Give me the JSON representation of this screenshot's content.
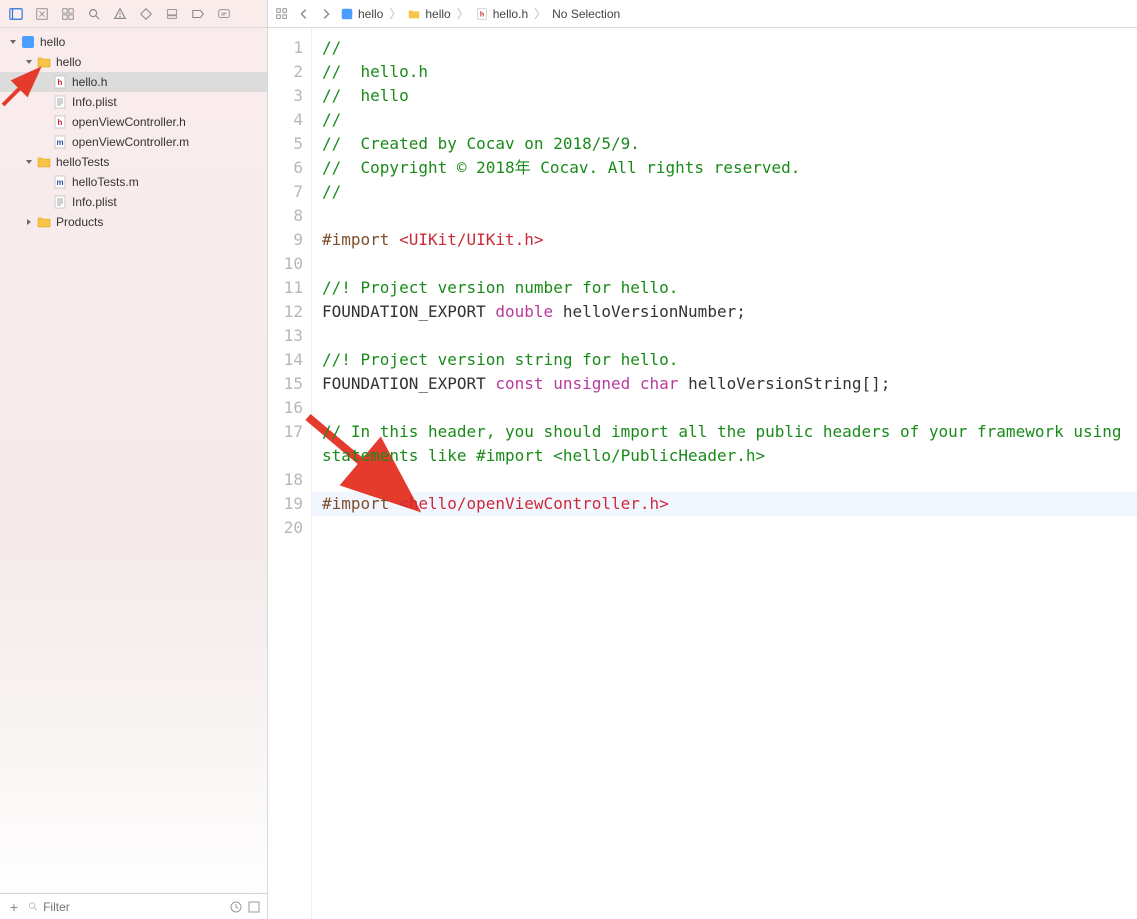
{
  "toolbar": {},
  "navigator": {
    "project": "hello",
    "folder_hello": "hello",
    "file_hello_h": "hello.h",
    "file_info_plist": "Info.plist",
    "file_ovc_h": "openViewController.h",
    "file_ovc_m": "openViewController.m",
    "folder_tests": "helloTests",
    "file_tests_m": "helloTests.m",
    "file_tests_plist": "Info.plist",
    "folder_products": "Products"
  },
  "filter": {
    "placeholder": "Filter"
  },
  "breadcrumb": {
    "proj": "hello",
    "folder": "hello",
    "file": "hello.h",
    "sel": "No Selection"
  },
  "code": {
    "lines": [
      {
        "n": 1,
        "seg": [
          {
            "cls": "c-comment",
            "t": "//"
          }
        ]
      },
      {
        "n": 2,
        "seg": [
          {
            "cls": "c-comment",
            "t": "//  hello.h"
          }
        ]
      },
      {
        "n": 3,
        "seg": [
          {
            "cls": "c-comment",
            "t": "//  hello"
          }
        ]
      },
      {
        "n": 4,
        "seg": [
          {
            "cls": "c-comment",
            "t": "//"
          }
        ]
      },
      {
        "n": 5,
        "seg": [
          {
            "cls": "c-comment",
            "t": "//  Created by Cocav on 2018/5/9."
          }
        ]
      },
      {
        "n": 6,
        "seg": [
          {
            "cls": "c-comment",
            "t": "//  Copyright © 2018年 Cocav. All rights reserved."
          }
        ]
      },
      {
        "n": 7,
        "seg": [
          {
            "cls": "c-comment",
            "t": "//"
          }
        ]
      },
      {
        "n": 8,
        "seg": [
          {
            "cls": "c-flat",
            "t": ""
          }
        ]
      },
      {
        "n": 9,
        "seg": [
          {
            "cls": "c-pre",
            "t": "#import "
          },
          {
            "cls": "c-include",
            "t": "<UIKit/UIKit.h>"
          }
        ]
      },
      {
        "n": 10,
        "seg": [
          {
            "cls": "c-flat",
            "t": ""
          }
        ]
      },
      {
        "n": 11,
        "seg": [
          {
            "cls": "c-comment",
            "t": "//! Project version number for hello."
          }
        ]
      },
      {
        "n": 12,
        "seg": [
          {
            "cls": "c-flat",
            "t": "FOUNDATION_EXPORT "
          },
          {
            "cls": "c-type",
            "t": "double"
          },
          {
            "cls": "c-flat",
            "t": " helloVersionNumber;"
          }
        ]
      },
      {
        "n": 13,
        "seg": [
          {
            "cls": "c-flat",
            "t": ""
          }
        ]
      },
      {
        "n": 14,
        "seg": [
          {
            "cls": "c-comment",
            "t": "//! Project version string for hello."
          }
        ]
      },
      {
        "n": 15,
        "seg": [
          {
            "cls": "c-flat",
            "t": "FOUNDATION_EXPORT "
          },
          {
            "cls": "c-type",
            "t": "const"
          },
          {
            "cls": "c-flat",
            "t": " "
          },
          {
            "cls": "c-type",
            "t": "unsigned"
          },
          {
            "cls": "c-flat",
            "t": " "
          },
          {
            "cls": "c-type",
            "t": "char"
          },
          {
            "cls": "c-flat",
            "t": " helloVersionString[];"
          }
        ]
      },
      {
        "n": 16,
        "seg": [
          {
            "cls": "c-flat",
            "t": ""
          }
        ]
      },
      {
        "n": 17,
        "seg": [
          {
            "cls": "c-comment",
            "t": "// In this header, you should import all the public headers of your framework using statements like #import <hello/PublicHeader.h>"
          }
        ],
        "wrapHeight": 2
      },
      {
        "n": 18,
        "seg": [
          {
            "cls": "c-flat",
            "t": ""
          }
        ]
      },
      {
        "n": 19,
        "seg": [
          {
            "cls": "c-pre",
            "t": "#import "
          },
          {
            "cls": "c-include",
            "t": "<hello/openViewController.h>"
          }
        ],
        "highlight": true
      },
      {
        "n": 20,
        "seg": [
          {
            "cls": "c-flat",
            "t": ""
          }
        ]
      }
    ]
  }
}
